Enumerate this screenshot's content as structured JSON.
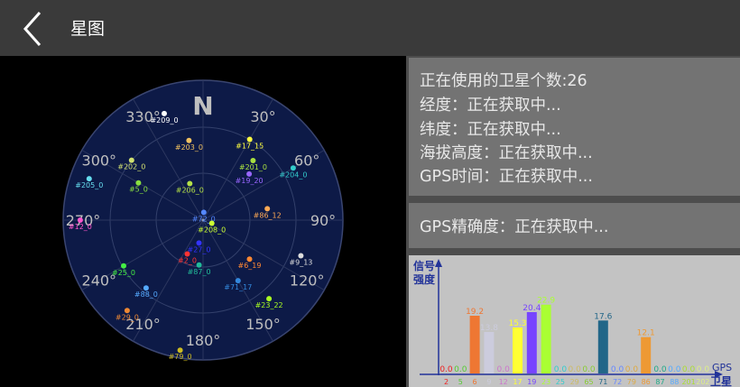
{
  "header": {
    "title": "星图"
  },
  "sky": {
    "north_label": "N",
    "degree_labels": [
      "30°",
      "60°",
      "90°",
      "120°",
      "150°",
      "180°",
      "210°",
      "240°",
      "270°",
      "300°",
      "330°"
    ],
    "satellites": [
      {
        "label": "#209_0",
        "az": 340,
        "el": 17,
        "color": "#ffffff"
      },
      {
        "label": "#203_0",
        "az": 350,
        "el": 38,
        "color": "#f0c060"
      },
      {
        "label": "#202_0",
        "az": 310,
        "el": 30,
        "color": "#d0e070"
      },
      {
        "label": "#5_0",
        "az": 300,
        "el": 42,
        "color": "#88e040"
      },
      {
        "label": "#206_0",
        "az": 340,
        "el": 65,
        "color": "#b4e048"
      },
      {
        "label": "#205_0",
        "az": 290,
        "el": 12,
        "color": "#66ddee"
      },
      {
        "label": "#17_15",
        "az": 30,
        "el": 30,
        "color": "#ffff40"
      },
      {
        "label": "#201_0",
        "az": 40,
        "el": 40,
        "color": "#a8e040"
      },
      {
        "label": "#19_20",
        "az": 45,
        "el": 48,
        "color": "#9966ff"
      },
      {
        "label": "#204_0",
        "az": 60,
        "el": 23,
        "color": "#33cccc"
      },
      {
        "label": "#86_12",
        "az": 80,
        "el": 48,
        "color": "#ffaa55"
      },
      {
        "label": "#72_0",
        "az": 5,
        "el": 85,
        "color": "#5588ff"
      },
      {
        "label": "#208_0",
        "az": 110,
        "el": 84,
        "color": "#ccff33"
      },
      {
        "label": "#12_0",
        "az": 270,
        "el": 11,
        "color": "#ff55cc"
      },
      {
        "label": "#6_19",
        "az": 130,
        "el": 51,
        "color": "#ff8833"
      },
      {
        "label": "#9_13",
        "az": 110,
        "el": 23,
        "color": "#dddddd"
      },
      {
        "label": "#27_0",
        "az": 190,
        "el": 75,
        "color": "#3333ff"
      },
      {
        "label": "#2_0",
        "az": 205,
        "el": 66,
        "color": "#ff3333"
      },
      {
        "label": "#87_0",
        "az": 185,
        "el": 61,
        "color": "#22bb99"
      },
      {
        "label": "#71_17",
        "az": 150,
        "el": 45,
        "color": "#3388dd"
      },
      {
        "label": "#23_22",
        "az": 140,
        "el": 24,
        "color": "#aaff22"
      },
      {
        "label": "#25_0",
        "az": 240,
        "el": 31,
        "color": "#44ee44"
      },
      {
        "label": "#88_0",
        "az": 220,
        "el": 33,
        "color": "#55aaff"
      },
      {
        "label": "#29_0",
        "az": 220,
        "el": 14,
        "color": "#ee8833"
      },
      {
        "label": "#79_0",
        "az": 190,
        "el": 5,
        "color": "#ccbb22"
      }
    ]
  },
  "info": {
    "in_use": "正在使用的卫星个数:26",
    "longitude": "经度：正在获取中...",
    "latitude": "纬度：正在获取中...",
    "altitude": "海拔高度：正在获取中...",
    "gps_time": "GPS时间：正在获取中..."
  },
  "accuracy": {
    "text": "GPS精确度：正在获取中..."
  },
  "chart_data": {
    "type": "bar",
    "ylabel_line1": "信号",
    "ylabel_line2": "强度",
    "xlabel_line1": "GPS",
    "xlabel_line2": "卫星",
    "categories": [
      "2",
      "5",
      "6",
      "9",
      "12",
      "17",
      "19",
      "23",
      "25",
      "29",
      "65",
      "71",
      "72",
      "79",
      "86",
      "87",
      "88",
      "201",
      "202"
    ],
    "values": [
      0.0,
      0.0,
      19.2,
      13.8,
      0.0,
      15.3,
      20.4,
      22.9,
      0.0,
      0.0,
      0.0,
      17.6,
      0.0,
      0.0,
      12.1,
      0.0,
      0.0,
      0.0,
      0.0
    ],
    "value_labels": [
      "0.0",
      "0.0",
      "19.2",
      "13.8",
      "0.0",
      "15.3",
      "20.4",
      "22.9",
      "0.0",
      "0.0",
      "0.0",
      "17.6",
      "0.0",
      "0.0",
      "12.1",
      "0.0",
      "0.0",
      "0.0",
      "0.0"
    ],
    "colors": [
      "#ee2222",
      "#55cc33",
      "#ee7733",
      "#ccccdd",
      "#cc77cc",
      "#ffff33",
      "#7744ff",
      "#aaff33",
      "#33cccc",
      "#ccbb66",
      "#88cc33",
      "#226688",
      "#6688ff",
      "#ddaa44",
      "#ee9933",
      "#22aa88",
      "#55aaff",
      "#aadd33",
      "#ddee88"
    ],
    "ylim": [
      0,
      30
    ]
  },
  "colors": {
    "topbar": "#3a3a3a",
    "panel": "#737373",
    "sky_fill": "#0d1a47",
    "grid": "#3a4570"
  }
}
